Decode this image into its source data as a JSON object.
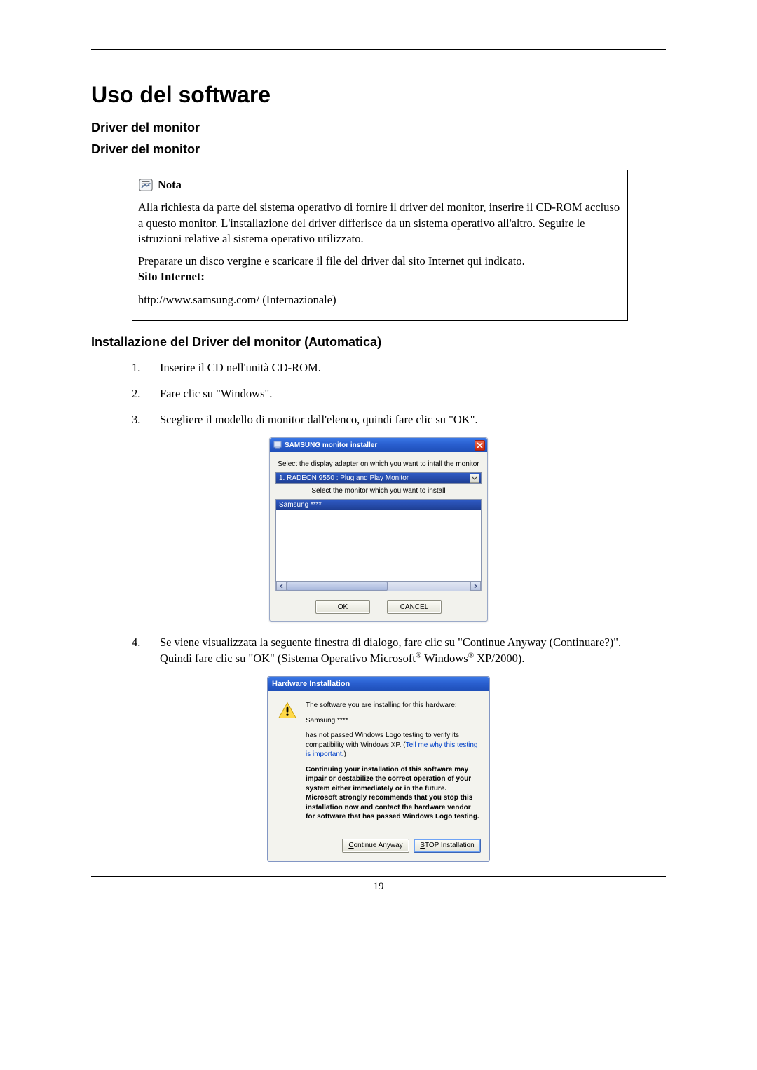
{
  "page": {
    "title": "Uso del software",
    "section1": "Driver del monitor",
    "section2": "Driver del monitor",
    "section3": "Installazione del Driver del monitor (Automatica)",
    "page_number": "19"
  },
  "note": {
    "label": "Nota",
    "p1": "Alla richiesta da parte del sistema operativo di fornire il driver del monitor, inserire il CD-ROM accluso a questo monitor. L'installazione del driver differisce da un sistema operativo all'altro. Seguire le istruzioni relative al sistema operativo utilizzato.",
    "p2": "Preparare un disco vergine e scaricare il file del driver dal sito Internet qui indicato.",
    "site_label": "Sito Internet:",
    "url": "http://www.samsung.com/ (Internazionale)"
  },
  "steps": {
    "s1_num": "1.",
    "s1_text": "Inserire il CD nell'unità CD-ROM.",
    "s2_num": "2.",
    "s2_text": "Fare clic su \"Windows\".",
    "s3_num": "3.",
    "s3_text": "Scegliere il modello di monitor dall'elenco, quindi fare clic su \"OK\".",
    "s4_num": "4.",
    "s4_text_pre": "Se viene visualizzata la seguente finestra di dialogo, fare clic su \"Continue Anyway (Continuare?)\". Quindi fare clic su \"OK\" (Sistema Operativo Microsoft",
    "s4_text_mid": " Windows",
    "s4_text_post": " XP/2000)."
  },
  "installer": {
    "title": "SAMSUNG monitor installer",
    "label_top": "Select the display adapter on which you want to intall the monitor",
    "combo_value": "1. RADEON 9550 : Plug and Play Monitor",
    "label_mid": "Select the monitor which you want to install",
    "list_selected": "Samsung ****",
    "btn_ok": "OK",
    "btn_cancel": "CANCEL"
  },
  "hwi": {
    "title": "Hardware Installation",
    "line1": "The software you are installing for this hardware:",
    "model": "Samsung ****",
    "line2_pre": "has not passed Windows Logo testing to verify its compatibility with Windows XP. (",
    "line2_link": "Tell me why this testing is important.",
    "line2_post": ")",
    "bold": "Continuing your installation of this software may impair or destabilize the correct operation of your system either immediately or in the future. Microsoft strongly recommends that you stop this installation now and contact the hardware vendor for software that has passed Windows Logo testing.",
    "btn_continue": "Continue Anyway",
    "btn_stop": "STOP Installation",
    "btn_continue_underline_char": "C",
    "btn_stop_underline_char": "S"
  },
  "icons": {
    "note": "note-icon",
    "close": "close-icon",
    "warn": "warning-icon"
  }
}
